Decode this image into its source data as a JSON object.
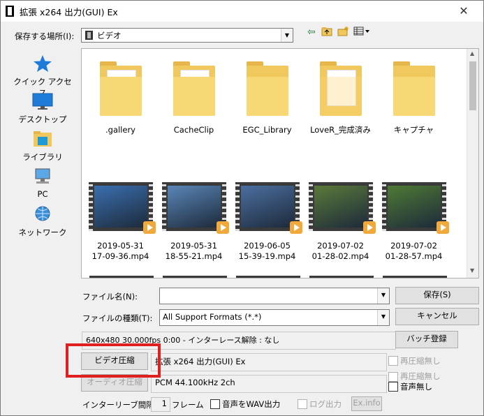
{
  "window": {
    "title": "拡張 x264 出力(GUI) Ex",
    "close_glyph": "✕"
  },
  "save_in": {
    "label": "保存する場所(I):",
    "value": "ビデオ"
  },
  "toolbar": {
    "back_icon": "back-arrow-icon",
    "up_icon": "up-folder-icon",
    "new_folder_icon": "new-folder-icon",
    "view_icon": "view-menu-icon"
  },
  "places": [
    {
      "label": "クイック アクセス",
      "icon": "star-icon"
    },
    {
      "label": "デスクトップ",
      "icon": "desktop-icon"
    },
    {
      "label": "ライブラリ",
      "icon": "library-icon"
    },
    {
      "label": "PC",
      "icon": "computer-icon"
    },
    {
      "label": "ネットワーク",
      "icon": "network-icon"
    }
  ],
  "folders": [
    {
      "name": ".gallery"
    },
    {
      "name": "CacheClip"
    },
    {
      "name": "EGC_Library"
    },
    {
      "name": "LoveR_完成済み"
    },
    {
      "name": "キャプチャ"
    }
  ],
  "videos": [
    {
      "line1": "2019-05-31",
      "line2": "17-09-36.mp4",
      "color": "#3a6fb0"
    },
    {
      "line1": "2019-05-31",
      "line2": "18-55-21.mp4",
      "color": "#5a86b8"
    },
    {
      "line1": "2019-06-05",
      "line2": "15-39-19.mp4",
      "color": "#4b6fa0"
    },
    {
      "line1": "2019-07-02",
      "line2": "01-28-02.mp4",
      "color": "#5b7a3a"
    },
    {
      "line1": "2019-07-02",
      "line2": "01-28-57.mp4",
      "color": "#4f7a35"
    }
  ],
  "form": {
    "filename_label": "ファイル名(N):",
    "filename_value": "",
    "filetype_label": "ファイルの種類(T):",
    "filetype_value": "All Support Formats (*.*)",
    "save_button": "保存(S)",
    "cancel_button": "キャンセル",
    "info_text": "640x480  30.000fps  0:00  -  インターレース解除 : なし",
    "batch_button": "バッチ登録",
    "video_compress_button": "ビデオ圧縮",
    "video_codec": "拡張 x264 出力(GUI) Ex",
    "no_recompress_label": "再圧縮無し",
    "audio_compress_button": "オーディオ圧縮",
    "audio_codec": "PCM 44.100kHz 2ch",
    "audio_no_recompress_label": "再圧縮無し",
    "no_audio_label": "音声無し",
    "interleave_label": "インターリーブ間隔 :",
    "interleave_value": "1",
    "frame_label": "フレーム",
    "wav_output_label": "音声をWAV出力",
    "log_output_label": "ログ出力",
    "exinfo_button": "Ex.info"
  }
}
